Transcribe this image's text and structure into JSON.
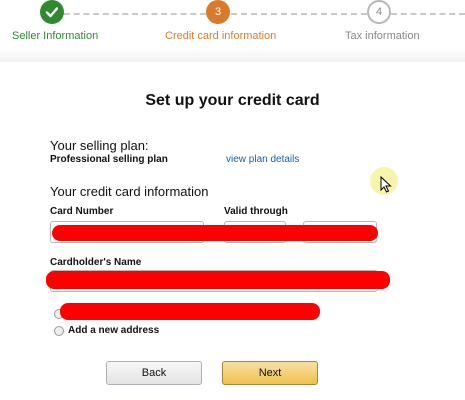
{
  "steps": [
    {
      "label": "Seller Information",
      "number": "",
      "state": "done",
      "icon": "checkmark-icon",
      "color": "#2f8a2f"
    },
    {
      "label": "Credit card information",
      "number": "3",
      "state": "current",
      "color": "#d97b2b"
    },
    {
      "label": "Tax information",
      "number": "4",
      "state": "upcoming",
      "color": "#888888"
    }
  ],
  "page": {
    "title": "Set up your credit card"
  },
  "selling_plan": {
    "heading": "Your selling plan:",
    "plan_name": "Professional selling plan",
    "link": "view plan details"
  },
  "credit_card": {
    "heading": "Your credit card information",
    "card_number_label": "Card Number",
    "valid_through_label": "Valid through",
    "cardholder_label": "Cardholder's Name"
  },
  "address": {
    "add_new_label": "Add a new address"
  },
  "buttons": {
    "back": "Back",
    "next": "Next"
  },
  "colors": {
    "link": "#1a62a8",
    "redaction": "#ff0000",
    "next_button": "#f0c14b",
    "step_done": "#2f8a2f",
    "step_current": "#d97b2b"
  }
}
